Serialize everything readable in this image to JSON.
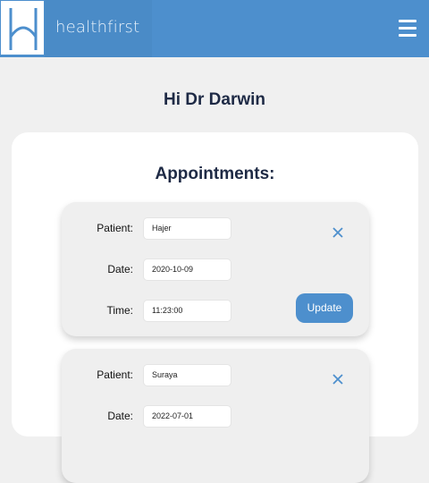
{
  "header": {
    "brand": "healthfirst",
    "logo_icon": "h-logo-icon",
    "menu_icon": "hamburger-menu-icon",
    "colors": {
      "bar": "#4d8fcd",
      "logo_bg": "#ffffff"
    }
  },
  "greeting": "Hi Dr Darwin",
  "appointments": {
    "title": "Appointments:",
    "labels": {
      "patient": "Patient:",
      "date": "Date:",
      "time": "Time:"
    },
    "close_icon": "close-x-icon",
    "update_label": "Update",
    "items": [
      {
        "patient": "Hajer",
        "date": "2020-10-09",
        "time": "11:23:00"
      },
      {
        "patient": "Suraya",
        "date": "2022-07-01",
        "time": ""
      }
    ]
  }
}
